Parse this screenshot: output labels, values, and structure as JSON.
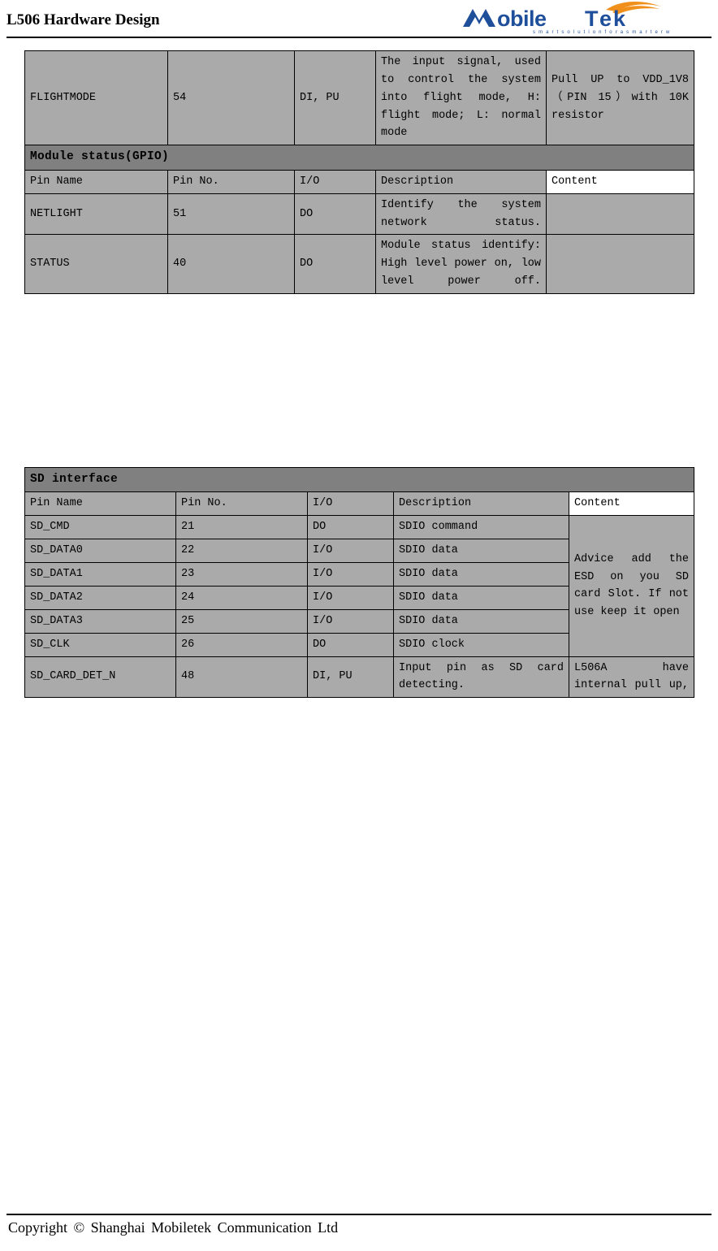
{
  "header": {
    "title": "L506 Hardware Design",
    "logo_text": "MobileTek",
    "logo_tagline": "s m a r t   s o l u t i o n   f o r   a   s m a r t e r   w o r l d"
  },
  "table_top": {
    "rows": [
      {
        "pin_name": "FLIGHTMODE",
        "pin_no": "54",
        "io": "DI, PU",
        "description": "The input signal, used to control the system into flight mode, H: flight mode; L: normal mode",
        "content": "Pull UP to VDD_1V8（PIN 15）with 10K resistor"
      }
    ]
  },
  "section_module_status": {
    "title": "Module status(GPIO)",
    "headers": {
      "pin_name": "Pin Name",
      "pin_no": "Pin No.",
      "io": "I/O",
      "description": "Description",
      "content": "Content"
    },
    "rows": [
      {
        "pin_name": "NETLIGHT",
        "pin_no": "51",
        "io": "DO",
        "description": "Identify the system network status.",
        "content": ""
      },
      {
        "pin_name": "STATUS",
        "pin_no": "40",
        "io": "DO",
        "description": "Module status identify: High level power on, low level power off.",
        "content": ""
      }
    ]
  },
  "section_sd_interface": {
    "title": "SD interface",
    "headers": {
      "pin_name": "Pin Name",
      "pin_no": "Pin No.",
      "io": "I/O",
      "description": "Description",
      "content": "Content"
    },
    "rows": [
      {
        "pin_name": "SD_CMD",
        "pin_no": "21",
        "io": "DO",
        "description": "SDIO command"
      },
      {
        "pin_name": "SD_DATA0",
        "pin_no": "22",
        "io": "I/O",
        "description": "SDIO data"
      },
      {
        "pin_name": "SD_DATA1",
        "pin_no": "23",
        "io": "I/O",
        "description": "SDIO data"
      },
      {
        "pin_name": "SD_DATA2",
        "pin_no": "24",
        "io": "I/O",
        "description": "SDIO data"
      },
      {
        "pin_name": "SD_DATA3",
        "pin_no": "25",
        "io": "I/O",
        "description": "SDIO data"
      },
      {
        "pin_name": "SD_CLK",
        "pin_no": "26",
        "io": "DO",
        "description": "SDIO clock"
      },
      {
        "pin_name": "SD_CARD_DET_N",
        "pin_no": "48",
        "io": "DI, PU",
        "description": "Input pin as SD card detecting."
      }
    ],
    "content_merged": "Advice add the ESD on you SD card Slot. If not use keep it open",
    "content_last": "L506A have internal pull up,"
  },
  "footer": {
    "text": "Copyright © Shanghai Mobiletek Communication Ltd"
  },
  "colors": {
    "cell_gray": "#aaaaaa",
    "section_gray": "#808080",
    "border": "#000000",
    "logo_blue": "#1f4f9a",
    "logo_orange": "#f0901a"
  }
}
